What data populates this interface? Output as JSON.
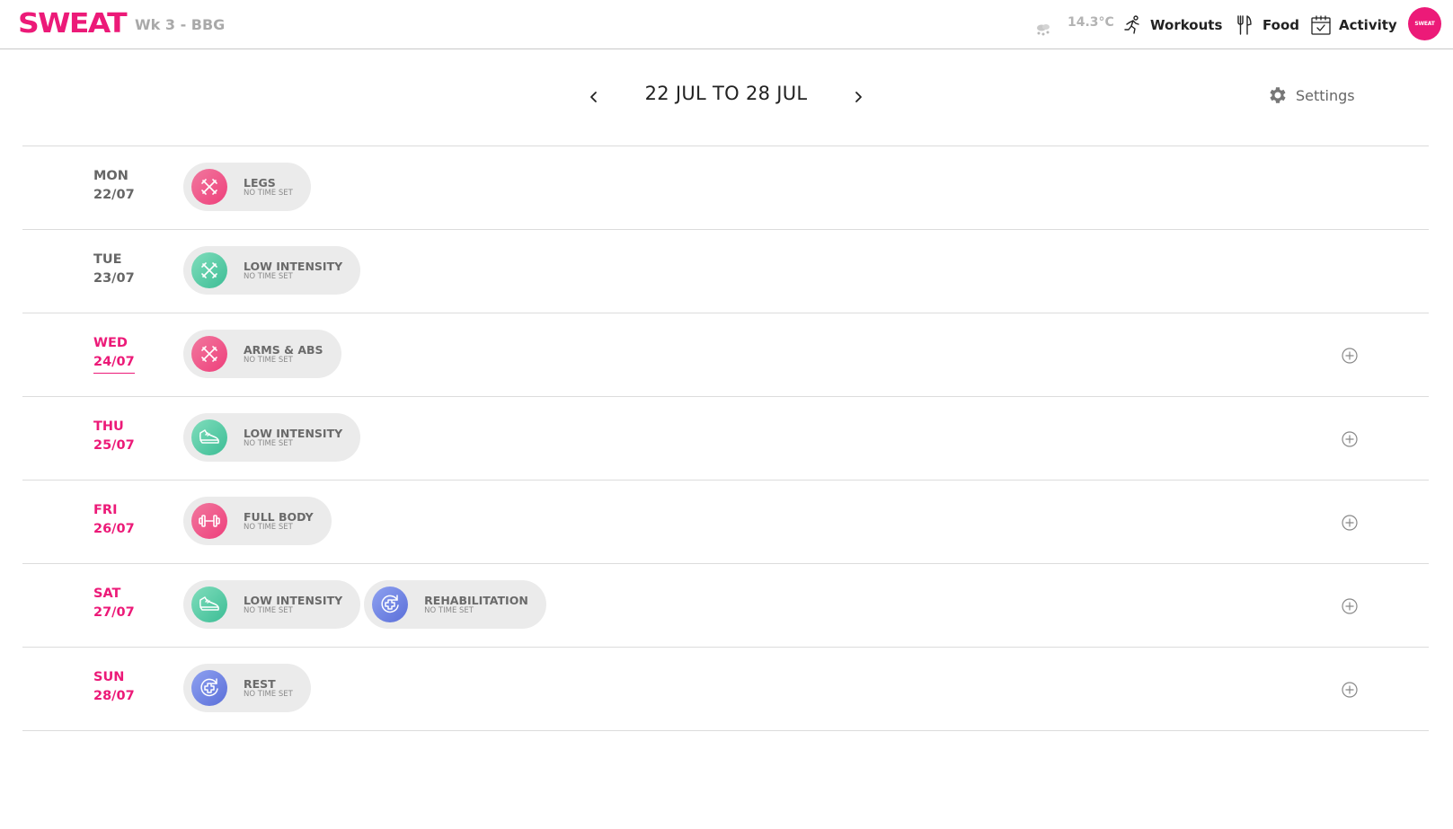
{
  "header": {
    "logo": "SWEAT",
    "program": "Wk 3 - BBG",
    "temperature": "14.3°C",
    "weather_icon": "rain-cloud-icon",
    "nav": [
      {
        "label": "Workouts",
        "icon": "running-person-icon"
      },
      {
        "label": "Food",
        "icon": "fork-knife-icon"
      },
      {
        "label": "Activity",
        "icon": "calendar-check-icon"
      }
    ],
    "avatar_text": "SWEAT"
  },
  "week": {
    "range": "22 JUL TO 28 JUL",
    "settings_label": "Settings"
  },
  "colors": {
    "accent": "#ec1a78",
    "pink_icon": "#ee3f7b",
    "teal_icon": "#3cbd95",
    "blue_icon": "#5b6fd9"
  },
  "days": [
    {
      "day": "MON",
      "date": "22/07",
      "active": false,
      "today": false,
      "add": false,
      "workouts": [
        {
          "name": "LEGS",
          "sub": "NO TIME SET",
          "color": "pink",
          "icon": "cross-icon"
        }
      ]
    },
    {
      "day": "TUE",
      "date": "23/07",
      "active": false,
      "today": false,
      "add": false,
      "workouts": [
        {
          "name": "LOW INTENSITY",
          "sub": "NO TIME SET",
          "color": "teal",
          "icon": "cross-icon"
        }
      ]
    },
    {
      "day": "WED",
      "date": "24/07",
      "active": true,
      "today": true,
      "add": true,
      "workouts": [
        {
          "name": "ARMS & ABS",
          "sub": "NO TIME SET",
          "color": "pink",
          "icon": "cross-icon"
        }
      ]
    },
    {
      "day": "THU",
      "date": "25/07",
      "active": true,
      "today": false,
      "add": true,
      "workouts": [
        {
          "name": "LOW INTENSITY",
          "sub": "NO TIME SET",
          "color": "teal",
          "icon": "sneaker-icon"
        }
      ]
    },
    {
      "day": "FRI",
      "date": "26/07",
      "active": true,
      "today": false,
      "add": true,
      "workouts": [
        {
          "name": "FULL BODY",
          "sub": "NO TIME SET",
          "color": "pink",
          "icon": "dumbbell-icon"
        }
      ]
    },
    {
      "day": "SAT",
      "date": "27/07",
      "active": true,
      "today": false,
      "add": true,
      "workouts": [
        {
          "name": "LOW INTENSITY",
          "sub": "NO TIME SET",
          "color": "teal",
          "icon": "sneaker-icon"
        },
        {
          "name": "REHABILITATION",
          "sub": "NO TIME SET",
          "color": "blue",
          "icon": "recovery-cross-icon"
        }
      ]
    },
    {
      "day": "SUN",
      "date": "28/07",
      "active": true,
      "today": false,
      "add": true,
      "workouts": [
        {
          "name": "REST",
          "sub": "NO TIME SET",
          "color": "blue",
          "icon": "recovery-cross-icon"
        }
      ]
    }
  ]
}
